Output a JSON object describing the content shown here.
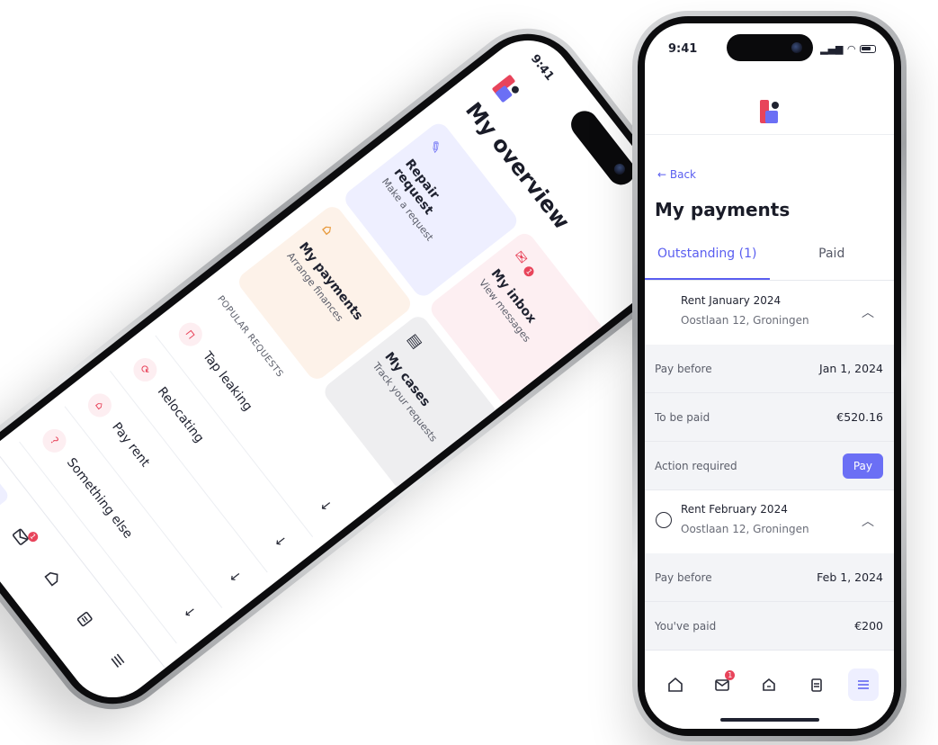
{
  "right_phone": {
    "status": {
      "time": "9:41"
    },
    "back_label": "← Back",
    "title": "My payments",
    "tabs": [
      {
        "label": "Outstanding (1)",
        "active": true
      },
      {
        "label": "Paid",
        "active": false
      }
    ],
    "payments": [
      {
        "name": "Rent January 2024",
        "address": "Oostlaan 12, Groningen",
        "rows": [
          {
            "label": "Pay before",
            "value": "Jan 1, 2024"
          },
          {
            "label": "To be paid",
            "value": "€520.16"
          }
        ],
        "action_label": "Action required",
        "pay_button": "Pay"
      },
      {
        "name": "Rent February 2024",
        "address": "Oostlaan 12, Groningen",
        "rows": [
          {
            "label": "Pay before",
            "value": "Feb 1, 2024"
          },
          {
            "label": "You've paid",
            "value": "€200"
          }
        ]
      }
    ],
    "nav": {
      "items": [
        "home-icon",
        "inbox-icon",
        "payments-icon",
        "cases-icon",
        "menu-icon"
      ],
      "inbox_badge": "1"
    }
  },
  "left_phone": {
    "status": {
      "time": "9:41"
    },
    "title": "My overview",
    "tiles": [
      {
        "title": "Repair request",
        "subtitle": "Make a request",
        "icon": "wrench-icon"
      },
      {
        "title": "My inbox",
        "subtitle": "View messages",
        "icon": "envelope-icon",
        "badge": "1"
      },
      {
        "title": "My payments",
        "subtitle": "Arrange finances",
        "icon": "house-euro-icon"
      },
      {
        "title": "My cases",
        "subtitle": "Track your requests",
        "icon": "clipboard-icon"
      }
    ],
    "popular_label": "POPULAR REQUESTS",
    "requests": [
      {
        "label": "Tap leaking",
        "icon": "tap-icon"
      },
      {
        "label": "Relocating",
        "icon": "relocate-icon"
      },
      {
        "label": "Pay rent",
        "icon": "house-icon"
      },
      {
        "label": "Something else",
        "icon": "help-icon"
      }
    ],
    "nav": {
      "inbox_badge": "1"
    }
  },
  "colors": {
    "accent": "#6b6ff5",
    "brand_red": "#e8445b",
    "tile_blue": "#eeefff",
    "tile_pink": "#fdeff2",
    "tile_peach": "#fdf2e9",
    "tile_grey": "#eeeef0"
  }
}
